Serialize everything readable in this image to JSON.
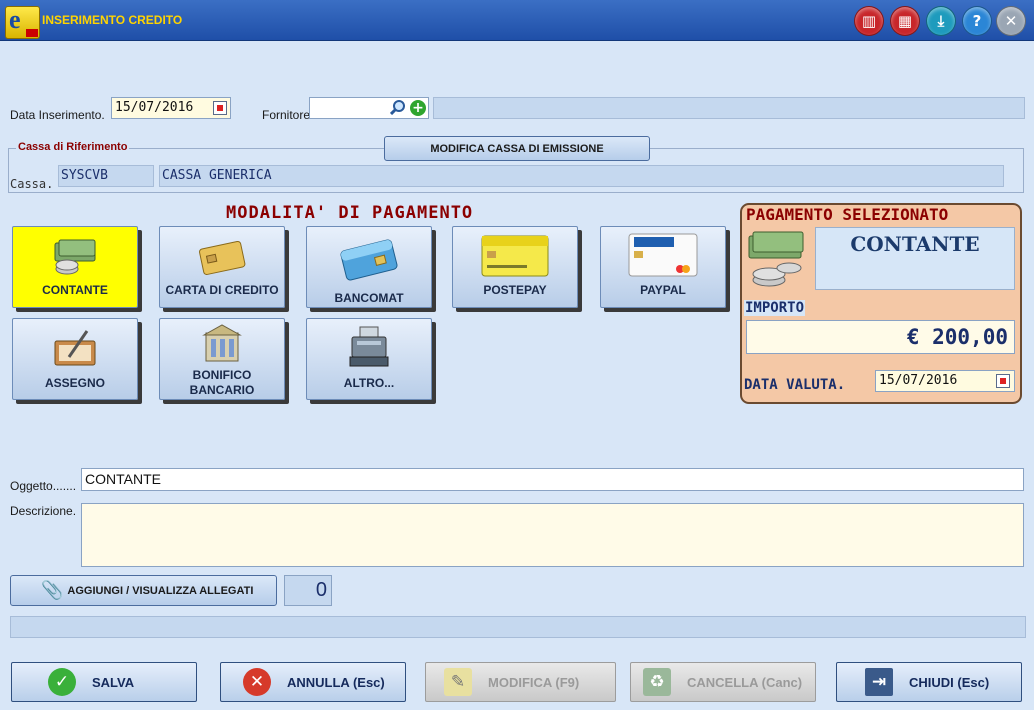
{
  "window": {
    "title": "INSERIMENTO CREDITO",
    "logo_letter": "e",
    "toolbar_icons": [
      "books-icon",
      "calculator-icon",
      "download-icon",
      "help-icon",
      "close-icon"
    ],
    "toolbar_glyphs": [
      "▥",
      "▦",
      "⤓",
      "?",
      "✕"
    ]
  },
  "form": {
    "data_inserimento_label": "Data Inserimento.",
    "data_inserimento_value": "15/07/2016",
    "fornitore_label": "Fornitore",
    "fornitore_value": "",
    "fornitore_name": ""
  },
  "cassa": {
    "legend": "Cassa di Riferimento",
    "modify_button": "MODIFICA CASSA DI EMISSIONE",
    "label": "Cassa.",
    "code": "SYSCVB",
    "name": "CASSA GENERICA"
  },
  "payment_methods": {
    "title": "MODALITA' DI PAGAMENTO",
    "items": [
      {
        "label": "CONTANTE",
        "selected": true
      },
      {
        "label": "CARTA DI CREDITO",
        "selected": false
      },
      {
        "label": "BANCOMAT",
        "selected": false
      },
      {
        "label": "POSTEPAY",
        "selected": false
      },
      {
        "label": "PAYPAL",
        "selected": false
      },
      {
        "label": "ASSEGNO",
        "selected": false
      },
      {
        "label": "BONIFICO",
        "label2": "BANCARIO",
        "selected": false
      },
      {
        "label": "ALTRO...",
        "selected": false
      }
    ]
  },
  "selected_payment": {
    "title": "PAGAMENTO SELEZIONATO",
    "method": "CONTANTE",
    "importo_label": "IMPORTO",
    "importo_value": "€ 200,00",
    "data_valuta_label": "DATA VALUTA.",
    "data_valuta_value": "15/07/2016"
  },
  "details": {
    "oggetto_label": "Oggetto.......",
    "oggetto_value": "CONTANTE",
    "descrizione_label": "Descrizione.",
    "descrizione_value": ""
  },
  "attachments": {
    "button_label": "AGGIUNGI / VISUALIZZA ALLEGATI",
    "count": "0"
  },
  "actions": {
    "salva": "SALVA",
    "annulla": "ANNULLA (Esc)",
    "modifica": "MODIFICA  (F9)",
    "cancella": "CANCELLA  (Canc)",
    "chiudi": "CHIUDI  (Esc)"
  },
  "colors": {
    "accent_title": "#8b0000",
    "selected_button": "#ffff00",
    "panel_bg": "#f4c8a6"
  }
}
